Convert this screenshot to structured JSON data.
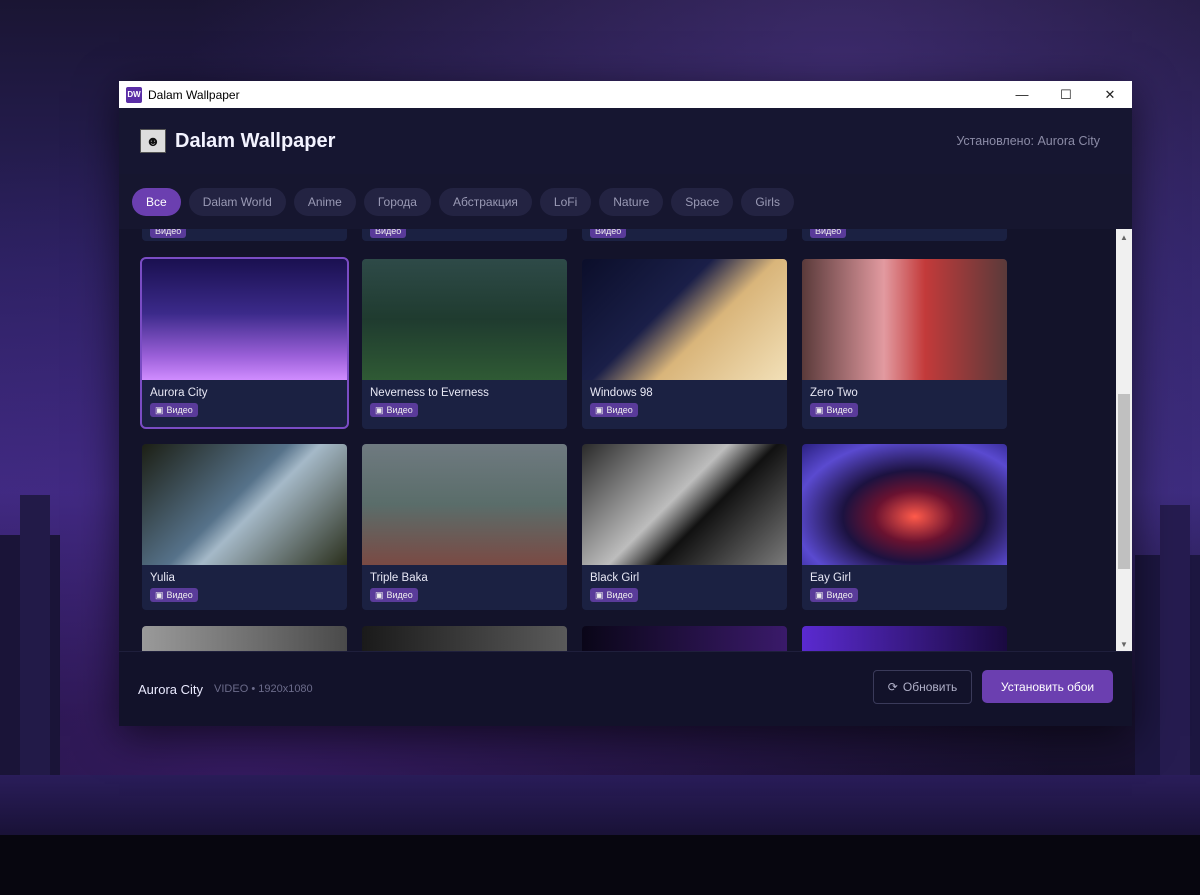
{
  "window": {
    "title": "Dalam Wallpaper",
    "app_icon_text": "DW",
    "controls": {
      "minimize": "—",
      "maximize": "☐",
      "close": "✕"
    }
  },
  "header": {
    "title": "Dalam Wallpaper",
    "installed": "Установлено: Aurora City"
  },
  "tabs": [
    {
      "label": "Все",
      "active": true
    },
    {
      "label": "Dalam World"
    },
    {
      "label": "Anime"
    },
    {
      "label": "Города"
    },
    {
      "label": "Абстракция"
    },
    {
      "label": "LoFi"
    },
    {
      "label": "Nature"
    },
    {
      "label": "Space"
    },
    {
      "label": "Girls"
    }
  ],
  "badge_label": "Видео",
  "wallpapers": [
    {
      "title": "Aurora City"
    },
    {
      "title": "Neverness to Everness"
    },
    {
      "title": "Windows 98"
    },
    {
      "title": "Zero Two"
    },
    {
      "title": "Yulia"
    },
    {
      "title": "Triple Baka"
    },
    {
      "title": "Black Girl"
    },
    {
      "title": "Eay Girl"
    }
  ],
  "footer": {
    "current_name": "Aurora City",
    "meta": "VIDEO  •  1920x1080",
    "refresh_label": "Обновить",
    "install_label": "Установить обои"
  }
}
